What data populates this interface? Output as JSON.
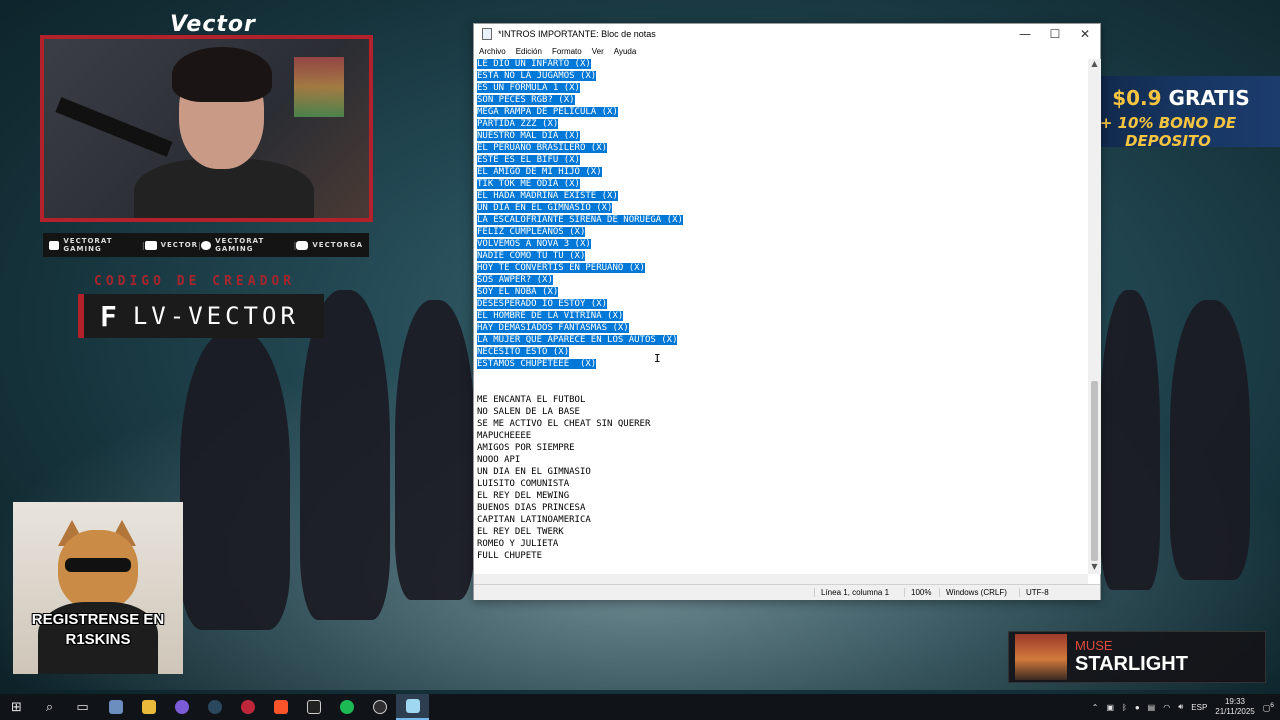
{
  "overlay": {
    "brand_title": "Vector",
    "social": [
      {
        "icon": "youtube-icon",
        "text": "VECTORAT GAMING"
      },
      {
        "icon": "twitch-icon",
        "text": "VECTOR"
      },
      {
        "icon": "steam-icon",
        "text": "VECTORAT GAMING"
      },
      {
        "icon": "instagram-icon",
        "text": "VECTORGA"
      }
    ],
    "creator_label": "CODIGO DE CREADOR",
    "creator_letter": "F",
    "creator_code": "LV-VECTOR",
    "cat_text": "REGISTRENSE EN\nR1SKINS",
    "promo_amount": "$0.9",
    "promo_free": "GRATIS",
    "promo_bonus": "+ 10% BONO DE DEPOSITO",
    "music_artist": "MUSE",
    "music_song": "STARLIGHT"
  },
  "notepad": {
    "title": "*INTROS IMPORTANTE: Bloc de notas",
    "menu": [
      "Archivo",
      "Edición",
      "Formato",
      "Ver",
      "Ayuda"
    ],
    "selected_lines": [
      "LE DIO UN INFARTO (X)",
      "ESTA NO LA JUGAMOS (X)",
      "ES UN FORMULA 1 (X)",
      "SON PECES RGB? (X)",
      "MEGA RAMPA DE PELICULA (X)",
      "PARTIDA ZZZ (X)",
      "NUESTRO MAL DIA (X)",
      "EL PERUANO BRASILERO (X)",
      "ESTE ES EL BIFU (X)",
      "EL AMIGO DE MI HIJO (X)",
      "TIK TOK ME ODIA (X)",
      "EL HADA MADRINA EXISTE (X)",
      "UN DIA EN EL GIMNASIO (X)",
      "LA ESCALOFRIANTE SIRENA DE NORUEGA (X)",
      "FELIZ CUMPLEAÑOS (X)",
      "VOLVEMOS A NOVA 3 (X)",
      "NADIE COMO TU TU (X)",
      "HOY TE CONVERTIS EN PERUANO (X)",
      "SOS AWPER? (X)",
      "SOY EL NOBA (X)",
      "DESESPERADO IO ESTOY (X)",
      "EL HOMBRE DE LA VITRINA (X)",
      "HAY DEMASIADOS FANTASMAS (X)",
      "LA MUJER QUE APARECE EN LOS AUTOS (X)",
      "NECESITO ESTO (X)",
      "ESTAMOS CHUPETEEE  (X)"
    ],
    "plain_lines": [
      "ME ENCANTA EL FUTBOL",
      "NO SALEN DE LA BASE",
      "SE ME ACTIVO EL CHEAT SIN QUERER",
      "MAPUCHEEEE",
      "AMIGOS POR SIEMPRE",
      "NOOO API",
      "UN DIA EN EL GIMNASIO",
      "LUISITO COMUNISTA",
      "EL REY DEL MEWING",
      "BUENOS DIAS PRINCESA",
      "CAPITAN LATINOAMERICA",
      "EL REY DEL TWERK",
      "ROMEO Y JULIETA",
      "FULL CHUPETE"
    ],
    "status": {
      "position": "Línea 1, columna 1",
      "zoom": "100%",
      "line_endings": "Windows (CRLF)",
      "encoding": "UTF-8"
    }
  },
  "taskbar": {
    "language": "ESP",
    "time": "19:33",
    "date": "21/11/2025",
    "notifications": "6"
  }
}
